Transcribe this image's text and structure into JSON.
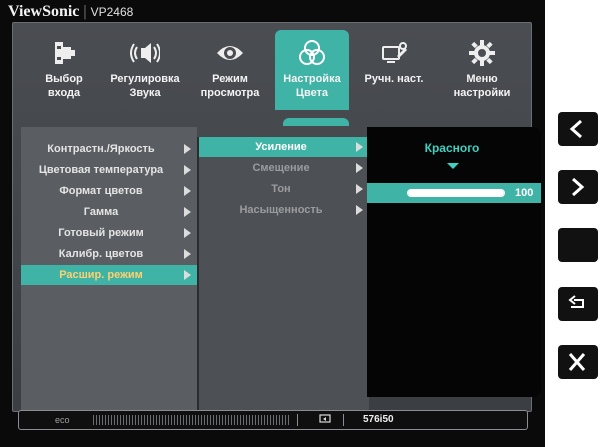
{
  "brand": {
    "name": "ViewSonic",
    "model": "VP2468"
  },
  "nav": [
    {
      "label_line1": "Выбор",
      "label_line2": "входа",
      "icon": "input-select-icon"
    },
    {
      "label_line1": "Регулировка",
      "label_line2": "Звука",
      "icon": "speaker-icon"
    },
    {
      "label_line1": "Режим",
      "label_line2": "просмотра",
      "icon": "eye-icon"
    },
    {
      "label_line1": "Настройка",
      "label_line2": "Цвета",
      "icon": "color-circles-icon",
      "active": true
    },
    {
      "label_line1": "Ручн. наст.",
      "label_line2": "",
      "icon": "manual-adjust-icon"
    },
    {
      "label_line1": "Меню",
      "label_line2": "настройки",
      "icon": "gear-icon"
    }
  ],
  "color_menu": {
    "items": [
      "Контрастн./Яркость",
      "Цветовая температура",
      "Формат цветов",
      "Гамма",
      "Готовый режим",
      "Калибр. цветов",
      "Расшир. режим"
    ],
    "selected_index": 6
  },
  "submenu": {
    "items": [
      "Усиление",
      "Смещение",
      "Тон",
      "Насыщенность"
    ],
    "selected_index": 0
  },
  "value_panel": {
    "channel_label": "Красного",
    "value": "100",
    "fill_fraction": 1.0
  },
  "status_bar": {
    "eco_label": "eco",
    "resolution": "576i50"
  },
  "side_buttons": [
    "chevron-left-icon",
    "chevron-right-icon",
    "blank-button",
    "return-icon",
    "close-icon"
  ],
  "colors": {
    "accent": "#3fb3a6",
    "panel": "#4a4d52",
    "highlight_text": "#ffd070"
  }
}
